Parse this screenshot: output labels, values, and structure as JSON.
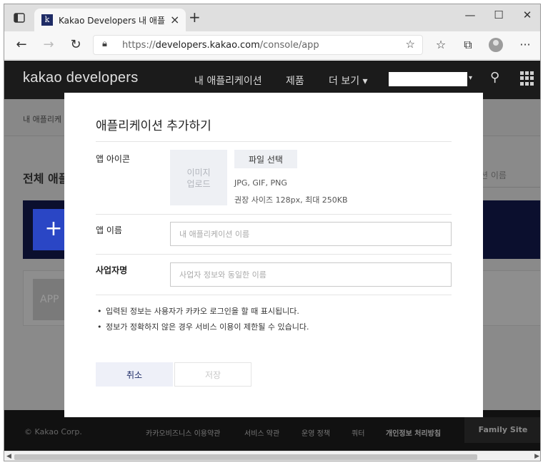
{
  "browser": {
    "tab_title": "Kakao Developers 내 애플리케이",
    "favicon_letter": "k",
    "url_scheme": "https://",
    "url_host": "developers.kakao.com",
    "url_path": "/console/app"
  },
  "site": {
    "logo": "kakao developers",
    "nav": [
      "내 애플리케이션",
      "제품",
      "더 보기 ▾"
    ],
    "dropdown_arrow": "▾"
  },
  "background": {
    "breadcrumb": "내 애플리케",
    "title": "전체 애플",
    "search_placeholder": "션 이름",
    "add_plus": "+",
    "app_thumb": "APP"
  },
  "modal": {
    "title": "애플리케이션 추가하기",
    "app_icon_label": "앱 아이콘",
    "icon_upload_line1": "이미지",
    "icon_upload_line2": "업로드",
    "file_button": "파일 선택",
    "icon_hint1": "JPG, GIF, PNG",
    "icon_hint2": "권장 사이즈 128px, 최대 250KB",
    "app_name_label": "앱 이름",
    "app_name_placeholder": "내 애플리케이션 이름",
    "company_label": "사업자명",
    "company_placeholder": "사업자 정보와 동일한 이름",
    "notes": [
      "입력된 정보는 사용자가 카카오 로그인을 할 때 표시됩니다.",
      "정보가 정확하지 않은 경우 서비스 이용이 제한될 수 있습니다."
    ],
    "cancel": "취소",
    "save": "저장"
  },
  "footer": {
    "copyright": "© Kakao Corp.",
    "links": [
      "카카오비즈니스 이용약관",
      "서비스 약관",
      "운영 정책",
      "쿼터",
      "개인정보 처리방침"
    ],
    "family_site": "Family Site"
  }
}
